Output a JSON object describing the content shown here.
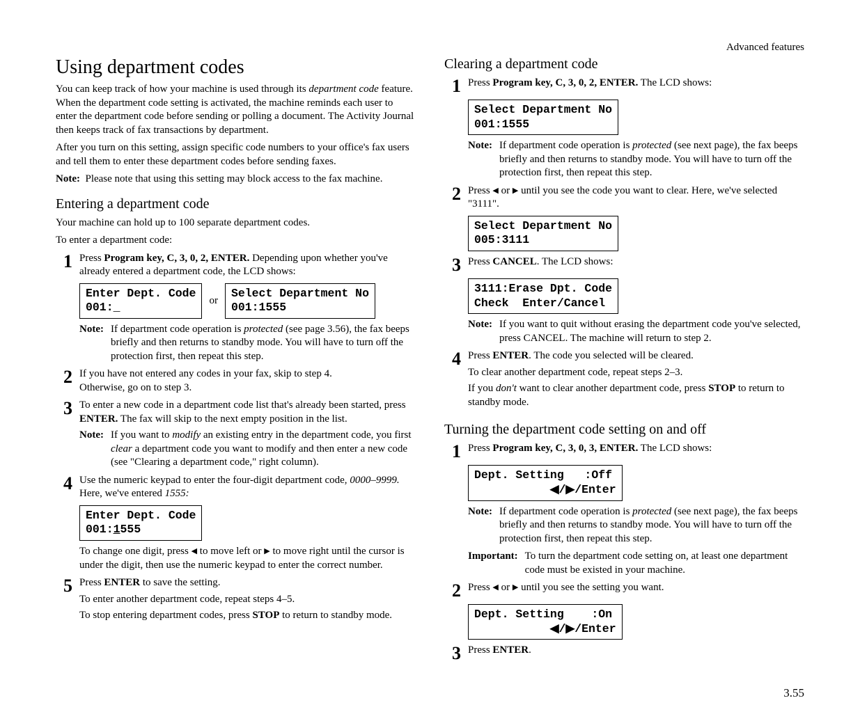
{
  "header": {
    "section": "Advanced features"
  },
  "left": {
    "h1": "Using department codes",
    "intro1_a": "You can keep track of how your machine is used through its ",
    "intro1_em": "department code",
    "intro1_b": " feature. When the department code setting is activated, the machine reminds each user to enter the department code before sending or polling a document. The Activity Journal then keeps track of fax transactions by department.",
    "intro2": "After you turn on this setting, assign specific code numbers to your office's fax users and tell them to enter these department codes before sending faxes.",
    "note1_lbl": "Note:",
    "note1_txt": "Please note that using this setting may block access to the fax machine.",
    "h2a": "Entering a department code",
    "sub1": "Your machine can hold up to 100 separate department codes.",
    "sub2": "To enter a department code:",
    "s1_a": "Press ",
    "s1_b": "Program key, ",
    "s1_sc": "C",
    "s1_c": ", 3, 0, 2, ",
    "s1_sc2": "ENTER.",
    "s1_d": " Depending upon whether you've already entered a department code, the ",
    "s1_sc3": "LCD",
    "s1_e": " shows:",
    "lcd1a": "Enter Dept. Code\n001:_",
    "or": "or",
    "lcd1b": "Select Department No\n001:1555",
    "s1_note_lbl": "Note:",
    "s1_note_a": "If department code operation is ",
    "s1_note_em": "protected",
    "s1_note_b": " (see page 3.56), the fax beeps briefly and then returns to standby mode. You will have to turn off the protection first, then repeat this step.",
    "s2": "If you have not entered any codes in your fax, skip to step 4.\nOtherwise, go on to step 3.",
    "s3_a": "To enter a new code in a department code list that's already been started, press ",
    "s3_sc": "ENTER.",
    "s3_b": " The fax will skip to the next empty position in the list.",
    "s3_note_lbl": "Note:",
    "s3_note_a": "If you want to ",
    "s3_note_em1": "modify",
    "s3_note_b": " an existing entry in the department code, you first ",
    "s3_note_em2": "clear",
    "s3_note_c": " a department code you want to modify and then enter a new code (see \"Clearing a department code,\" right column).",
    "s4_a": "Use the numeric keypad to enter the four-digit department code, ",
    "s4_em1": "0000–9999.",
    "s4_b": " Here, we've entered ",
    "s4_em2": "1555:",
    "lcd4": "Enter Dept. Code\n001:1555",
    "s4_after_a": "To change one digit, press ",
    "s4_after_b": " to move left or ",
    "s4_after_c": " to move right until the cursor is under the digit, then use the numeric keypad to enter the correct number.",
    "s5_a": "Press ",
    "s5_sc": "ENTER",
    "s5_b": " to save the setting.",
    "s5_c": "To enter another department code, repeat steps 4–5.",
    "s5_d_a": "To stop entering department codes, press ",
    "s5_d_sc": "STOP",
    "s5_d_b": " to return to standby mode.",
    "lcd4_underline_note": "_"
  },
  "right": {
    "h2a": "Clearing a department code",
    "c1_a": "Press ",
    "c1_b": "Program key, ",
    "c1_sc1": "C",
    "c1_c": ", 3, 0, 2, ",
    "c1_sc2": "ENTER.",
    "c1_d": " The ",
    "c1_sc3": "LCD",
    "c1_e": " shows:",
    "lcd_c1": "Select Department No\n001:1555",
    "c1_note_lbl": "Note:",
    "c1_note_a": "If department code operation is ",
    "c1_note_em": "protected",
    "c1_note_b": " (see next page), the fax beeps briefly and then returns to standby mode. You will have to turn off the protection first, then repeat this step.",
    "c2_a": "Press ",
    "c2_b": " or ",
    "c2_c": " until you see the code you want to clear. Here, we've selected \"3111\".",
    "lcd_c2": "Select Department No\n005:3111",
    "c3_a": "Press ",
    "c3_sc": "CANCEL",
    "c3_b": ". The ",
    "c3_sc2": "LCD",
    "c3_c": " shows:",
    "lcd_c3": "3111:Erase Dpt. Code\nCheck  Enter/Cancel",
    "c3_note_lbl": "Note:",
    "c3_note_a": "If you want to quit without erasing the department code you've selected, press ",
    "c3_note_sc": "CANCEL",
    "c3_note_b": ". The machine will return to step 2.",
    "c4_a": "Press ",
    "c4_sc": "ENTER",
    "c4_b": ". The code you selected will be cleared.",
    "c4_c": "To clear another department code, repeat steps 2–3.",
    "c4_d_a": "If you ",
    "c4_d_em": "don't",
    "c4_d_b": " want to clear another department code, press ",
    "c4_d_sc": "STOP",
    "c4_d_c": " to return to standby mode.",
    "h2b": "Turning the department code setting on and off",
    "t1_a": "Press ",
    "t1_b": "Program key, ",
    "t1_sc1": "C",
    "t1_c": ", 3, 0, 3, ",
    "t1_sc2": "ENTER.",
    "t1_d": " The ",
    "t1_sc3": "LCD",
    "t1_e": " shows:",
    "lcd_t1": "Dept. Setting   :Off\n           ◀/▶/Enter",
    "t1_note_lbl": "Note:",
    "t1_note_a": "If department code operation is ",
    "t1_note_em": "protected",
    "t1_note_b": " (see next page), the fax beeps briefly and then returns to standby mode. You will have to turn off the protection first, then repeat this step.",
    "t1_imp_lbl": "Important:",
    "t1_imp_txt": "To turn the department code setting on, at least one department code must be existed in your machine.",
    "t2_a": "Press ",
    "t2_b": " or ",
    "t2_c": " until you see the setting you want.",
    "lcd_t2": "Dept. Setting    :On\n           ◀/▶/Enter",
    "t3_a": "Press ",
    "t3_sc": "ENTER",
    "t3_b": "."
  },
  "pagenum": "3.55"
}
